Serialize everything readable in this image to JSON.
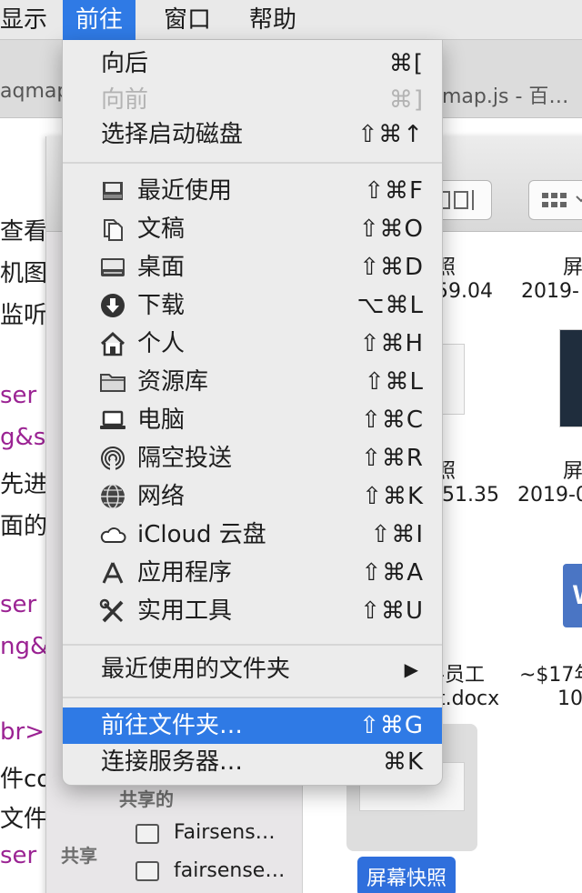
{
  "menubar": {
    "items": [
      "显示",
      "前往",
      "窗口",
      "帮助"
    ],
    "active": "前往"
  },
  "background": {
    "tab_left": "aqmap",
    "tab_right": "map.js - 百…",
    "code_lines": [
      {
        "text": "查看",
        "kind": "tx"
      },
      {
        "text": "机图",
        "kind": "tx"
      },
      {
        "text": "监听",
        "kind": "tx"
      },
      {
        "text": "ser",
        "kind": "kw"
      },
      {
        "text": "g&s",
        "kind": "kw"
      },
      {
        "text": "先进",
        "kind": "tx"
      },
      {
        "text": "面的",
        "kind": "tx"
      },
      {
        "text": "ser",
        "kind": "kw"
      },
      {
        "text": "ng&",
        "kind": "kw"
      },
      {
        "text": "br>",
        "kind": "kw"
      },
      {
        "text": "件co",
        "kind": "tx"
      },
      {
        "text": "文件",
        "kind": "tx"
      },
      {
        "text": "ser",
        "kind": "kw"
      }
    ]
  },
  "finder": {
    "sidebar_head_shared": "共享的",
    "sidebar_head_share": "共享",
    "sidebar_items": [
      "Fairsens…",
      "fairsense…"
    ],
    "files": [
      {
        "line1": "照",
        "line2": "59.04"
      },
      {
        "line1": "屏",
        "line2": "2019-"
      },
      {
        "line1": "照",
        "line2": ".51.35"
      },
      {
        "line1": "屏",
        "line2": "2019-0"
      },
      {
        "line1": "-员工",
        "line2": "t.docx"
      },
      {
        "line1": "~$17年",
        "line2": "10"
      }
    ],
    "word_letter": "W",
    "selected_label": "屏幕快照"
  },
  "menu": {
    "items": [
      {
        "label": "向后",
        "shortcut": "⌘[",
        "state": "normal"
      },
      {
        "label": "向前",
        "shortcut": "⌘]",
        "state": "disabled"
      },
      {
        "label": "选择启动磁盘",
        "shortcut": "⇧⌘↑",
        "state": "normal"
      },
      {
        "label": "最近使用",
        "shortcut": "⇧⌘F",
        "icon": "recents-icon"
      },
      {
        "label": "文稿",
        "shortcut": "⇧⌘O",
        "icon": "documents-icon"
      },
      {
        "label": "桌面",
        "shortcut": "⇧⌘D",
        "icon": "desktop-icon"
      },
      {
        "label": "下载",
        "shortcut": "⌥⌘L",
        "icon": "downloads-icon"
      },
      {
        "label": "个人",
        "shortcut": "⇧⌘H",
        "icon": "home-icon"
      },
      {
        "label": "资源库",
        "shortcut": "⇧⌘L",
        "icon": "library-folder-icon"
      },
      {
        "label": "电脑",
        "shortcut": "⇧⌘C",
        "icon": "computer-icon"
      },
      {
        "label": "隔空投送",
        "shortcut": "⇧⌘R",
        "icon": "airdrop-icon"
      },
      {
        "label": "网络",
        "shortcut": "⇧⌘K",
        "icon": "network-globe-icon"
      },
      {
        "label": "iCloud 云盘",
        "shortcut": "⇧⌘I",
        "icon": "icloud-icon"
      },
      {
        "label": "应用程序",
        "shortcut": "⇧⌘A",
        "icon": "applications-icon"
      },
      {
        "label": "实用工具",
        "shortcut": "⇧⌘U",
        "icon": "utilities-icon"
      },
      {
        "label": "最近使用的文件夹",
        "submenu": "▶"
      },
      {
        "label": "前往文件夹…",
        "shortcut": "⇧⌘G",
        "state": "highlighted"
      },
      {
        "label": "连接服务器…",
        "shortcut": "⌘K",
        "state": "normal"
      }
    ]
  },
  "colors": {
    "highlight": "#2f7ae5",
    "menu_bg": "#ececec",
    "disabled_text": "#b3b3b3",
    "code_keyword": "#9b2393"
  }
}
